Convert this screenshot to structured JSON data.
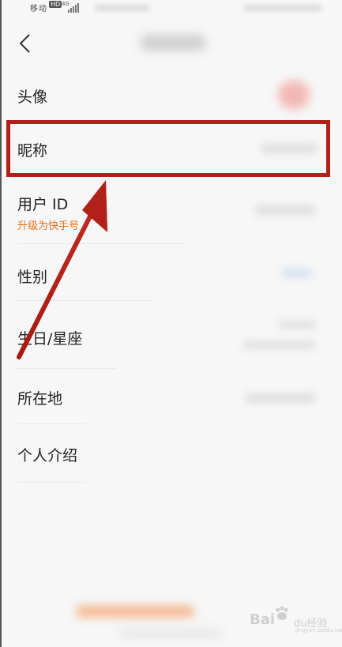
{
  "status_bar": {
    "carrier": "移动",
    "hd": "HD",
    "net": "4G"
  },
  "navbar": {
    "back_icon": "chevron-left-icon"
  },
  "rows": [
    {
      "label": "头像"
    },
    {
      "label": "昵称"
    },
    {
      "label": "用户 ID",
      "sub": "升级为快手号"
    },
    {
      "label": "性别"
    },
    {
      "label": "生日/星座"
    },
    {
      "label": "所在地"
    },
    {
      "label": "个人介绍"
    }
  ],
  "annotation": {
    "highlight_color": "#b22119",
    "arrow_color": "#b22119"
  },
  "watermark": {
    "brand": "Bai",
    "brand_end": "du",
    "text": "经验",
    "url": "jingyan.baidu.com"
  }
}
